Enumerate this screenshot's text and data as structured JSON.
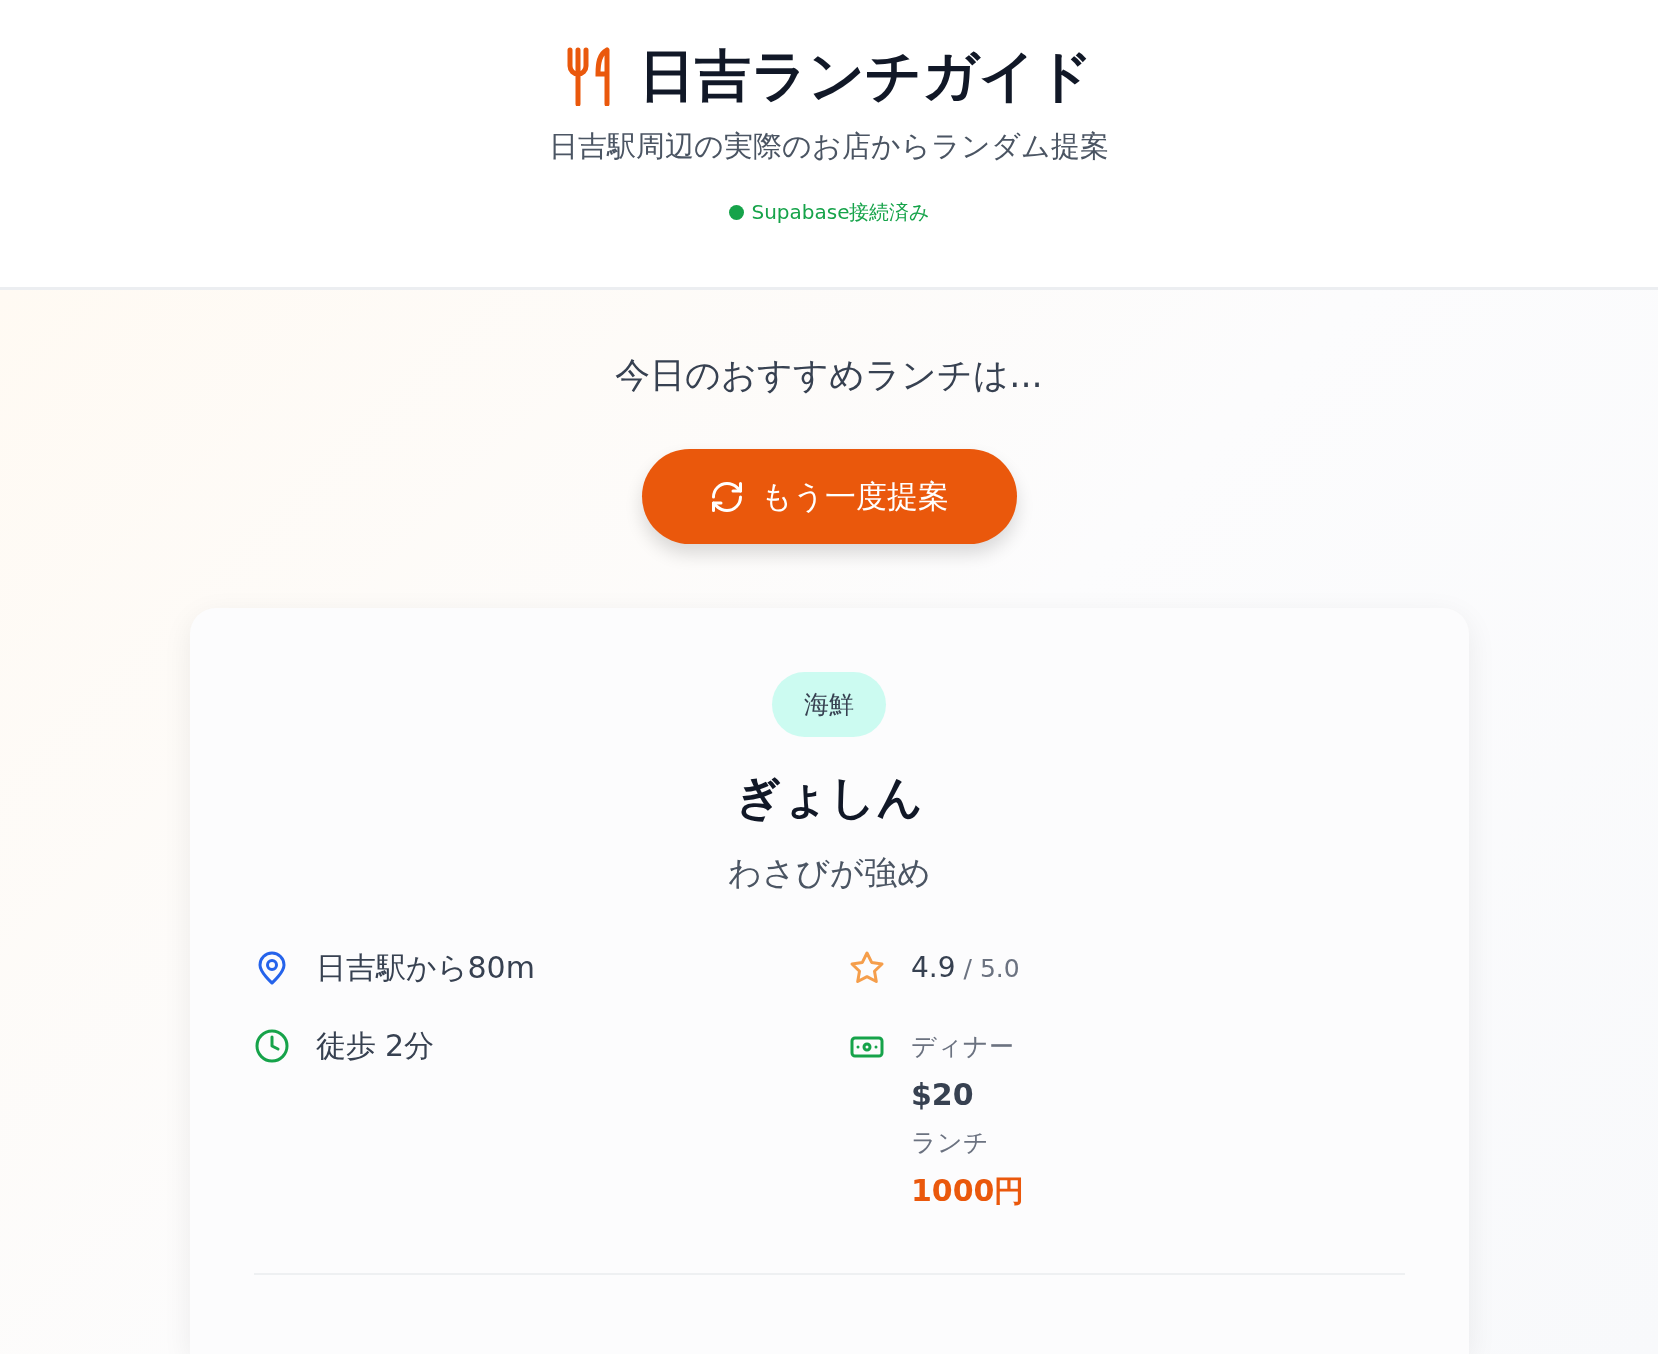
{
  "header": {
    "title": "日吉ランチガイド",
    "subtitle": "日吉駅周辺の実際のお店からランダム提案",
    "status": {
      "label": "Supabase接続済み",
      "connected": true
    }
  },
  "prompt": "今日のおすすめランチは...",
  "retry_button": {
    "label": "もう一度提案"
  },
  "restaurant": {
    "category": "海鮮",
    "name": "ぎょしん",
    "description": "わさびが強め",
    "distance": "日吉駅から80m",
    "walk": "徒歩 2分",
    "rating": "4.9",
    "rating_max": "/ 5.0",
    "prices": [
      {
        "label": "ディナー",
        "amount": "$20",
        "highlight": false
      },
      {
        "label": "ランチ",
        "amount": "1000円",
        "highlight": true
      }
    ]
  }
}
